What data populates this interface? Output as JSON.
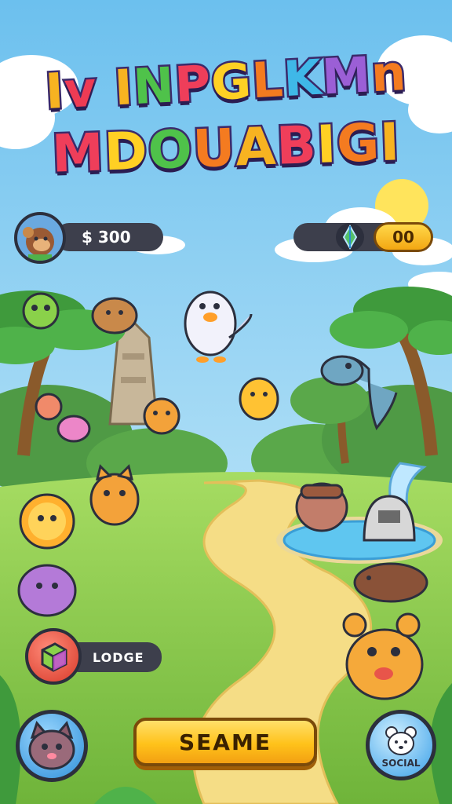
{
  "title": {
    "line1": [
      {
        "ch": "I",
        "color": "#f7b321"
      },
      {
        "ch": "v",
        "color": "#ee3b54"
      },
      {
        "ch": " ",
        "color": "#ffffff"
      },
      {
        "ch": "I",
        "color": "#f7b321"
      },
      {
        "ch": "N",
        "color": "#4fc24a"
      },
      {
        "ch": "P",
        "color": "#ef3e5a"
      },
      {
        "ch": "G",
        "color": "#ffd024"
      },
      {
        "ch": "L",
        "color": "#f47b20"
      },
      {
        "ch": "K",
        "color": "#3fb8e8"
      },
      {
        "ch": "M",
        "color": "#9b5fd6"
      },
      {
        "ch": "n",
        "color": "#f47b20"
      }
    ],
    "line2": [
      {
        "ch": "M",
        "color": "#ef3e5a"
      },
      {
        "ch": "D",
        "color": "#ffd024"
      },
      {
        "ch": "O",
        "color": "#4fc24a"
      },
      {
        "ch": "U",
        "color": "#f47b20"
      },
      {
        "ch": "A",
        "color": "#f7b321"
      },
      {
        "ch": "B",
        "color": "#ef3e5a"
      },
      {
        "ch": "I",
        "color": "#ffd024"
      },
      {
        "ch": "G",
        "color": "#f47b20"
      },
      {
        "ch": "I",
        "color": "#f7b321"
      }
    ]
  },
  "hud": {
    "coins": "$ 300",
    "gems": "00"
  },
  "lodge": {
    "label": "LODGE",
    "icon": "cube-icon"
  },
  "play_button": {
    "label": "SEAME"
  },
  "social": {
    "label": "SOCIAL",
    "icon": "bear-icon"
  },
  "pet_button": {
    "icon": "cat-face-icon"
  },
  "colors": {
    "sky_top": "#7fc8f0",
    "sky_bottom": "#cfeefa",
    "grass": "#8fcf4f",
    "path": "#f7e08a",
    "accent_gold": "#ffc21a",
    "pill_dark": "#3d3f4c"
  }
}
